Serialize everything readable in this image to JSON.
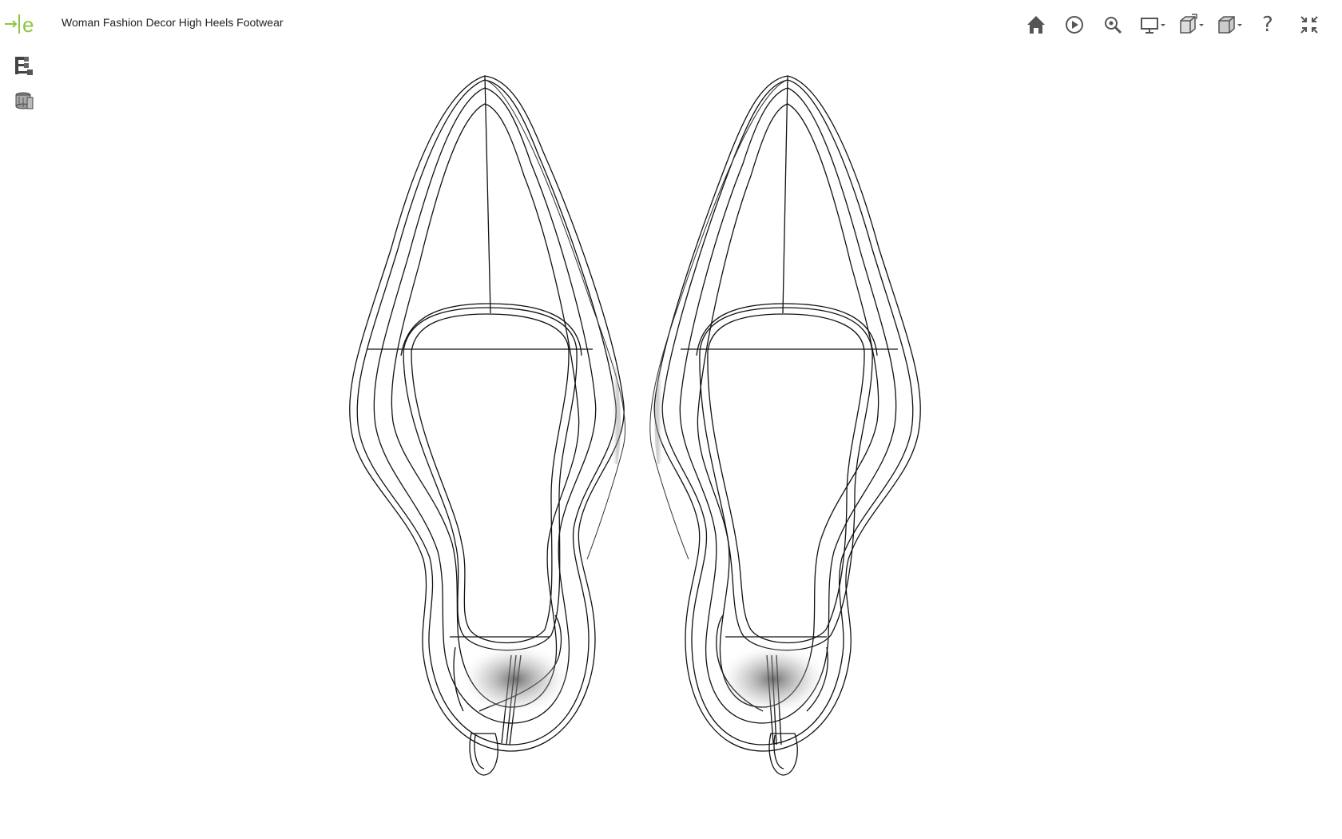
{
  "app": {
    "logo_glyph": "e",
    "title": "Woman Fashion Decor High Heels Footwear",
    "accent_color": "#8dc63f"
  },
  "sidebar": {
    "tools": [
      {
        "name": "model-tree",
        "icon": "tree-hierarchy-icon"
      },
      {
        "name": "parts",
        "icon": "layers-icon"
      }
    ]
  },
  "toolbar": {
    "buttons": [
      {
        "name": "home",
        "icon": "home-icon"
      },
      {
        "name": "play",
        "icon": "play-icon"
      },
      {
        "name": "zoom",
        "icon": "zoom-icon"
      },
      {
        "name": "display",
        "icon": "monitor-icon",
        "has_dropdown": true
      },
      {
        "name": "view-orientation",
        "icon": "cube-rotate-icon",
        "has_dropdown": true
      },
      {
        "name": "view-style",
        "icon": "cube-icon",
        "has_dropdown": true
      },
      {
        "name": "help",
        "icon": "help-icon",
        "glyph": "?"
      },
      {
        "name": "exit-fullscreen",
        "icon": "collapse-arrows-icon"
      }
    ]
  },
  "viewport": {
    "content": "wireframe-3d-model",
    "model_count": 2
  }
}
